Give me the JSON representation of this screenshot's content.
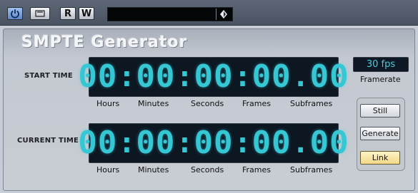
{
  "toolbar": {
    "read_label": "R",
    "write_label": "W",
    "icons": [
      "power-icon",
      "bypass-icon",
      "preset-arrow-icon"
    ]
  },
  "panel": {
    "title": "SMPTE Generator",
    "start_time": {
      "label": "START TIME",
      "hours": "00",
      "minutes": "00",
      "seconds": "00",
      "frames": "00",
      "subframes": "00"
    },
    "current_time": {
      "label": "CURRENT TIME",
      "hours": "00",
      "minutes": "00",
      "seconds": "00",
      "frames": "00",
      "subframes": "00"
    },
    "units": [
      "Hours",
      "Minutes",
      "Seconds",
      "Frames",
      "Subframes"
    ],
    "framerate_value": "30 fps",
    "framerate_label": "Framerate",
    "buttons": {
      "still": "Still",
      "generate": "Generate",
      "link": "Link"
    }
  },
  "colors": {
    "display_digits": "#35c7d4",
    "link_active": "#f2d98a",
    "power_active": "#5f86c6"
  }
}
